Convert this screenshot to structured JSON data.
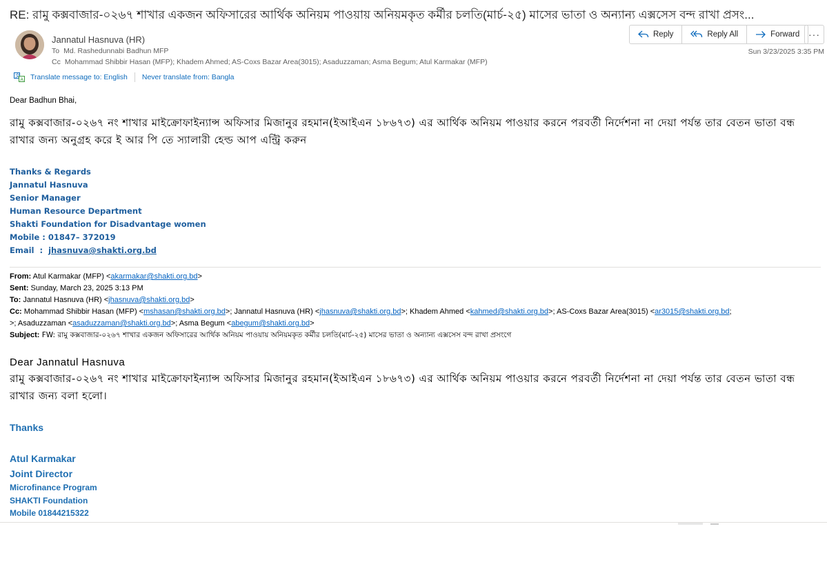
{
  "message": {
    "subject": "RE: রামু কক্সবাজার-০২৬৭ শাখার একজন অফিসারের আর্থিক অনিয়ম পাওয়ায় অনিয়মকৃত কর্মীর চলতি(মার্চ-২৫) মাসের ভাতা ও অন্যান্য এক্সসেস বন্দ রাখা প্রসং...",
    "sender": "Jannatul Hasnuva (HR)",
    "to_label": "To",
    "to": "Md. Rashedunnabi Badhun MFP",
    "cc_label": "Cc",
    "cc": "Mohammad Shibbir Hasan (MFP); Khadem Ahmed; AS-Coxs Bazar Area(3015); Asaduzzaman; Asma Begum; Atul  Karmakar (MFP)",
    "timestamp": "Sun 3/23/2025 3:35 PM"
  },
  "actions": {
    "reply": "Reply",
    "reply_all": "Reply All",
    "forward": "Forward",
    "more": "···"
  },
  "translate": {
    "translate_to": "Translate message to: English",
    "never_translate": "Never translate from: Bangla"
  },
  "body": {
    "greeting": "Dear Badhun Bhai,",
    "text": "রামু কক্সবাজার-০২৬৭ নং শাখার মাইক্রোফাইন্যান্স অফিসার মিজানুর রহমান(ইআইএন ১৮৬৭৩) এর আর্থিক অনিয়ম পাওয়ার করনে পরবর্তী নির্দেশনা না দেয়া পর্যন্ত তার বেতন ভাতা বন্ধ রাখার জন্য অনুগ্রহ করে ই আর পি তে স্যালারী হেল্ড আপ এন্ট্রি করুন",
    "signature": {
      "regards": "Thanks & Regards",
      "name": "Jannatul Hasnuva",
      "title": "Senior Manager",
      "department": "Human Resource Department",
      "org": "Shakti Foundation for Disadvantage women",
      "mobile": "Mobile : 01847– 372019",
      "email_label": "Email  :  ",
      "email": "jhasnuva@shakti.org.bd"
    }
  },
  "quoted": {
    "from_label": "From:",
    "from_name": " Atul Karmakar (MFP) <",
    "from_email": "akarmakar@shakti.org.bd",
    "sent_label": "Sent:",
    "sent": " Sunday, March 23, 2025 3:13 PM",
    "to_label": "To:",
    "to_name": " Jannatul Hasnuva (HR) <",
    "to_email": "jhasnuva@shakti.org.bd",
    "cc_label": "Cc:",
    "cc_1_name": " Mohammad Shibbir Hasan (MFP) <",
    "cc_1_email": "mshasan@shakti.org.bd",
    "cc_2_name": ">; Jannatul Hasnuva (HR) <",
    "cc_2_email": "jhasnuva@shakti.org.bd",
    "cc_3_name": ">; Khadem Ahmed <",
    "cc_3_email": "kahmed@shakti.org.bd",
    "cc_4_name": ">; AS-Coxs Bazar Area(3015) <",
    "cc_4_email": "ar3015@shakti.org.bd",
    "cc_5_name": ">; Asaduzzaman <",
    "cc_5_email": "asaduzzaman@shakti.org.bd",
    "cc_6_name": ">; Asma Begum <",
    "cc_6_email": "abegum@shakti.org.bd",
    "subject_label": "Subject:",
    "subject": " FW: রামু কক্সবাজার-০২৬৭ শাখার একজন অফিসারের আর্থিক অনিয়ম পাওয়ায় অনিয়মকৃত কর্মীর চলতি(মার্চ-২৫) মাসের ভাতা ও অন্যান্য এক্সসেস বন্দ রাখা প্রসংগে",
    "greeting": "Dear  Jannatul  Hasnuva",
    "text": "রামু কক্সবাজার-০২৬৭ নং শাখার মাইক্রোফাইন্যান্স অফিসার মিজানুর রহমান(ইআইএন ১৮৬৭৩) এর আর্থিক অনিয়ম পাওয়ার করনে পরবর্তী নির্দেশনা না দেয়া পর্যন্ত তার বেতন ভাতা বন্ধ রাখার জন্য বলা হলো।",
    "thanks": "Thanks",
    "signature": {
      "name": "Atul Karmakar",
      "title": "Joint Director",
      "program": "Microfinance Program",
      "org": "SHAKTI Foundation",
      "mobile": "Mobile 01844215322"
    }
  },
  "colors": {
    "link": "#0f6cbd",
    "signature": "#1f5f9e",
    "quoted_signature": "#1f6fb2"
  }
}
